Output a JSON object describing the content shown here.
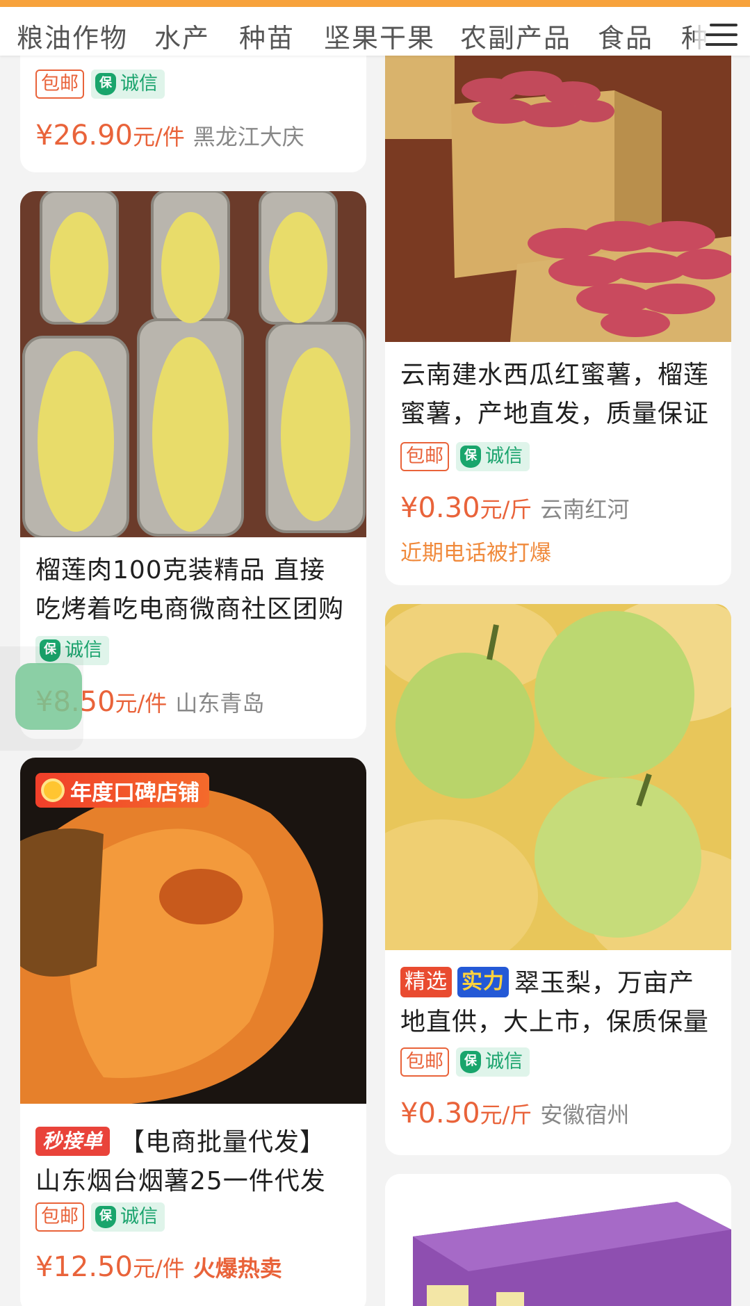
{
  "categories": [
    "粮油作物",
    "水产",
    "种苗",
    "坚果干果",
    "农副产品",
    "食品",
    "种"
  ],
  "tags": {
    "free_shipping": "包邮",
    "integrity": "诚信",
    "shield": "保"
  },
  "products": {
    "p0": {
      "price": "¥26.90",
      "unit": "元/件",
      "location": "黑龙江大庆"
    },
    "p1": {
      "title": "榴莲肉100克装精品 直接吃烤着吃电商微商社区团购",
      "price": "¥8.50",
      "unit": "元/件",
      "location": "山东青岛"
    },
    "p2": {
      "badge_banner": "年度口碑店铺",
      "badge": "秒接单",
      "title": "【电商批量代发】山东烟台烟薯25一件代发",
      "price": "¥12.50",
      "unit": "元/件",
      "highlight": "火爆热卖"
    },
    "p3": {
      "title": "云南建水西瓜红蜜薯，榴莲蜜薯，产地直发，质量保证",
      "price": "¥0.30",
      "unit": "元/斤",
      "location": "云南红河",
      "note": "近期电话被打爆"
    },
    "p4": {
      "badge_select": "精选",
      "badge_strength": "实力",
      "title": "翠玉梨，万亩产地直供，大上市，保质保量",
      "price": "¥0.30",
      "unit": "元/斤",
      "location": "安徽宿州"
    }
  },
  "colors": {
    "accent": "#e9633a",
    "integrity": "#19a56c",
    "top_bar": "#f7a23b"
  }
}
